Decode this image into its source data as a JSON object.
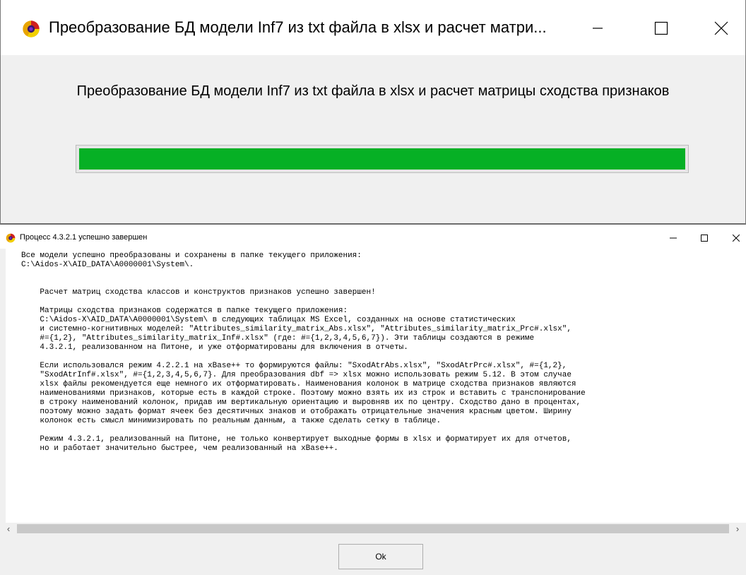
{
  "progress_window": {
    "title": "Преобразование БД модели Inf7 из txt файла в xlsx и расчет матри...",
    "caption": "Преобразование БД модели Inf7 из txt файла в xlsx и расчет матрицы сходства признаков",
    "progress_fraction": 1.0,
    "progress_color": "#06b025"
  },
  "result_window": {
    "title": "Процесс 4.3.2.1 успешно завершен",
    "lines": [
      "Все модели успешно преобразованы и сохранены в папке текущего приложения:",
      "C:\\Aidos-X\\AID_DATA\\A0000001\\System\\.",
      "",
      "",
      "    Расчет матриц сходства классов и конструктов признаков успешно завершен!",
      "",
      "    Матрицы сходства признаков содержатся в папке текущего приложения:",
      "    C:\\Aidos-X\\AID_DATA\\A0000001\\System\\ в следующих таблицах MS Excel, созданных на основе статистических",
      "    и системно-когнитивных моделей: \"Attributes_similarity_matrix_Abs.xlsx\", \"Attributes_similarity_matrix_Prc#.xlsx\",",
      "    #={1,2}, \"Attributes_similarity_matrix_Inf#.xlsx\" (где: #={1,2,3,4,5,6,7}). Эти таблицы создаются в режиме",
      "    4.3.2.1, реализованном на Питоне, и уже отформатированы для включения в отчеты.",
      "",
      "    Если использовался режим 4.2.2.1 на xBase++ то формируются файлы: \"SxodAtrAbs.xlsx\", \"SxodAtrPrc#.xlsx\", #={1,2},",
      "    \"SxodAtrInf#.xlsx\", #={1,2,3,4,5,6,7}. Для преобразования dbf => xlsx можно использовать режим 5.12. В этом случае",
      "    xlsx файлы рекомендуется еще немного их отформатировать. Наименования колонок в матрице сходства признаков являются",
      "    наименованиями признаков, которые есть в каждой строке. Поэтому можно взять их из строк и вставить с транспонирование",
      "    в строку наименований колонок, придав им вертикальную ориентацию и выровняв их по центру. Сходство дано в процентах,",
      "    поэтому можно задать формат ячеек без десятичных знаков и отображать отрицательные значения красным цветом. Ширину",
      "    колонок есть смысл минимизировать по реальным данным, а также сделать сетку в таблице.",
      "",
      "    Режим 4.3.2.1, реализованный на Питоне, не только конвертирует выходные формы в xlsx и форматирует их для отчетов,",
      "    но и работает значительно быстрее, чем реализованный на xBase++."
    ],
    "ok_label": "Ok"
  },
  "icons": {
    "app": "aidos-app-icon",
    "minimize": "minimize-icon",
    "maximize": "maximize-icon",
    "close": "close-icon",
    "scroll_left": "scroll-left-icon",
    "scroll_right": "scroll-right-icon"
  }
}
